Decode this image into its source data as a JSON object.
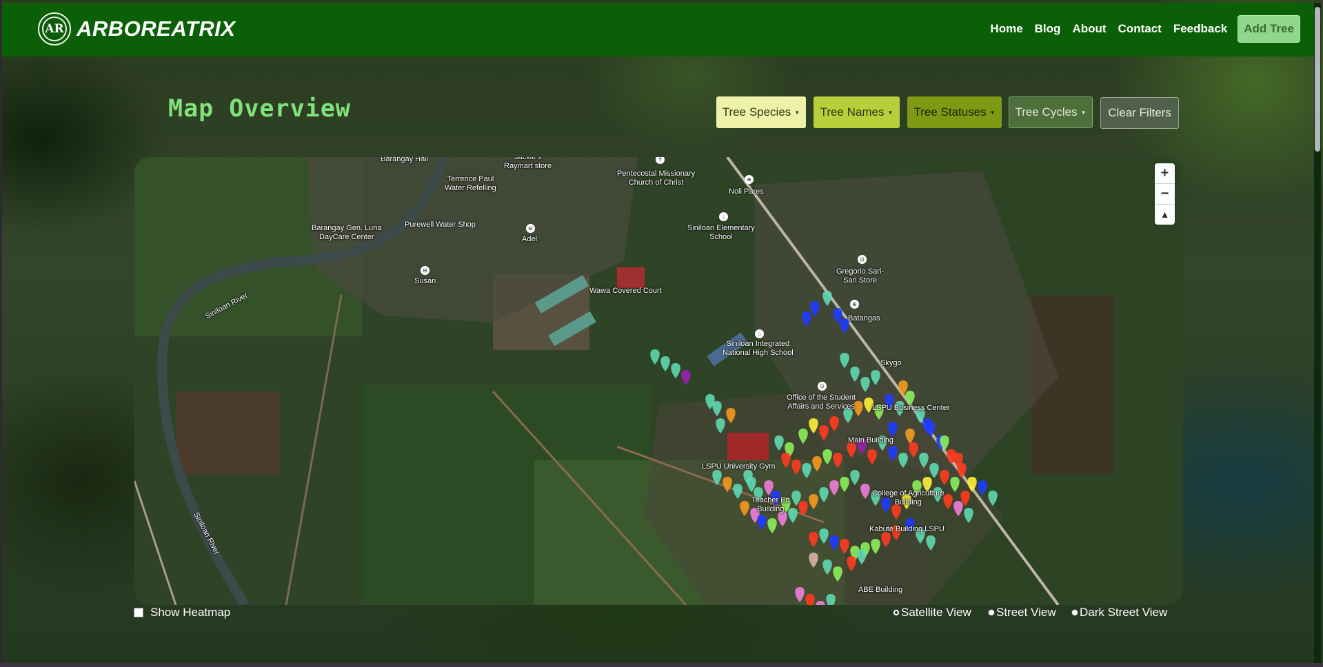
{
  "brand": {
    "name": "ARBOREATRIX",
    "logo_text": "AR"
  },
  "nav": {
    "links": [
      "Home",
      "Blog",
      "About",
      "Contact",
      "Feedback"
    ],
    "add_tree": "Add Tree"
  },
  "page": {
    "title": "Map Overview"
  },
  "filters": {
    "species": "Tree Species",
    "names": "Tree Names",
    "statuses": "Tree Statuses",
    "cycles": "Tree Cycles",
    "clear": "Clear Filters"
  },
  "map": {
    "labels": {
      "barangay_hall": "Barangay Hall",
      "jackie": "Jackie's\nRaymart store",
      "terrence": "Terrence Paul\nWater Refelling",
      "pentecostal": "Pentecostal Missionary\nChurch of Christ",
      "noli": "Noli Pares",
      "brgy_luna": "Barangay Gen. Luna\nDayCare Center",
      "purewell": "Purewell Water Shop",
      "adel": "Adel",
      "siniloan_elem": "Siniloan Elementary\nSchool",
      "gregorio": "Gregorio Sari-\nSari Store",
      "susan": "Susan",
      "wawa": "Wawa Covered Court",
      "river1": "Siniloan River",
      "batangas": "Batangas",
      "siniloan_integrated": "Siniloan Integrated\nNational High School",
      "skygo": "Skygo",
      "student_affairs": "Office of the Student\nAffairs and Services",
      "lspu_center": "LSPU Business Center",
      "lspu_building": "Main Building",
      "lspu_gym": "LSPU University Gym",
      "teacher": "Teacher Ed\nBuilding",
      "college_agri": "College of Agriculture\nBuilding",
      "kabute": "Kabute Building LSPU",
      "river2": "Siniloan River",
      "abe": "ABE Building"
    },
    "zoom_in": "+",
    "zoom_out": "−",
    "compass": "▲"
  },
  "controls": {
    "heatmap": "Show Heatmap",
    "satellite": "Satellite View",
    "street": "Street View",
    "dark_street": "Dark Street View",
    "selected_view": "Satellite View"
  },
  "colors": {
    "navbar": "#0b5f06",
    "title": "#7fe27b",
    "species_btn": "#eef2a8",
    "names_btn": "#b8ce3a",
    "statuses_btn": "#7e9a14",
    "cycles_btn": "#4d6f3a",
    "clear_btn": "#51604a"
  },
  "markers": {
    "colors": [
      "#5fd8b0",
      "#ff3b1f",
      "#1f3bff",
      "#8cf05a",
      "#f59a1f",
      "#f07dd8",
      "#9c1fb0",
      "#d8b0a0",
      "#ffef3a"
    ],
    "points": [
      [
        1170,
        460,
        2
      ],
      [
        1182,
        445,
        2
      ],
      [
        1200,
        430,
        0
      ],
      [
        1215,
        455,
        2
      ],
      [
        1225,
        470,
        2
      ],
      [
        950,
        515,
        0
      ],
      [
        965,
        525,
        0
      ],
      [
        980,
        535,
        0
      ],
      [
        995,
        545,
        6
      ],
      [
        1030,
        580,
        0
      ],
      [
        1040,
        590,
        0
      ],
      [
        1060,
        600,
        4
      ],
      [
        1045,
        615,
        0
      ],
      [
        1225,
        520,
        0
      ],
      [
        1240,
        540,
        0
      ],
      [
        1255,
        555,
        0
      ],
      [
        1270,
        545,
        0
      ],
      [
        1130,
        640,
        0
      ],
      [
        1145,
        650,
        3
      ],
      [
        1165,
        630,
        3
      ],
      [
        1180,
        615,
        8
      ],
      [
        1195,
        625,
        1
      ],
      [
        1210,
        612,
        1
      ],
      [
        1230,
        600,
        0
      ],
      [
        1245,
        590,
        4
      ],
      [
        1260,
        585,
        8
      ],
      [
        1275,
        595,
        3
      ],
      [
        1290,
        580,
        2
      ],
      [
        1305,
        590,
        0
      ],
      [
        1320,
        575,
        3
      ],
      [
        1335,
        600,
        0
      ],
      [
        1350,
        620,
        2
      ],
      [
        1365,
        640,
        2
      ],
      [
        1380,
        660,
        1
      ],
      [
        1395,
        680,
        1
      ],
      [
        1410,
        700,
        8
      ],
      [
        1425,
        705,
        2
      ],
      [
        1440,
        720,
        0
      ],
      [
        1310,
        560,
        4
      ],
      [
        1140,
        665,
        1
      ],
      [
        1155,
        675,
        1
      ],
      [
        1170,
        680,
        0
      ],
      [
        1185,
        670,
        4
      ],
      [
        1200,
        660,
        3
      ],
      [
        1215,
        665,
        1
      ],
      [
        1235,
        650,
        1
      ],
      [
        1250,
        645,
        6
      ],
      [
        1265,
        660,
        1
      ],
      [
        1280,
        640,
        0
      ],
      [
        1295,
        655,
        2
      ],
      [
        1310,
        665,
        0
      ],
      [
        1325,
        650,
        1
      ],
      [
        1340,
        665,
        0
      ],
      [
        1355,
        680,
        0
      ],
      [
        1370,
        690,
        1
      ],
      [
        1385,
        700,
        3
      ],
      [
        1400,
        720,
        1
      ],
      [
        1090,
        700,
        0
      ],
      [
        1100,
        715,
        0
      ],
      [
        1115,
        705,
        5
      ],
      [
        1125,
        720,
        2
      ],
      [
        1140,
        730,
        3
      ],
      [
        1155,
        720,
        0
      ],
      [
        1080,
        735,
        4
      ],
      [
        1095,
        745,
        5
      ],
      [
        1105,
        755,
        2
      ],
      [
        1120,
        760,
        3
      ],
      [
        1135,
        750,
        5
      ],
      [
        1150,
        745,
        0
      ],
      [
        1165,
        735,
        1
      ],
      [
        1180,
        725,
        4
      ],
      [
        1195,
        715,
        0
      ],
      [
        1210,
        705,
        5
      ],
      [
        1225,
        700,
        3
      ],
      [
        1240,
        690,
        0
      ],
      [
        1255,
        710,
        5
      ],
      [
        1270,
        720,
        0
      ],
      [
        1285,
        730,
        2
      ],
      [
        1300,
        740,
        1
      ],
      [
        1315,
        725,
        8
      ],
      [
        1330,
        705,
        3
      ],
      [
        1345,
        700,
        8
      ],
      [
        1360,
        715,
        0
      ],
      [
        1375,
        725,
        1
      ],
      [
        1390,
        735,
        5
      ],
      [
        1405,
        745,
        0
      ],
      [
        1180,
        780,
        1
      ],
      [
        1195,
        775,
        0
      ],
      [
        1210,
        785,
        2
      ],
      [
        1225,
        790,
        1
      ],
      [
        1240,
        800,
        3
      ],
      [
        1255,
        795,
        3
      ],
      [
        1270,
        790,
        3
      ],
      [
        1285,
        780,
        1
      ],
      [
        1300,
        770,
        1
      ],
      [
        1320,
        760,
        2
      ],
      [
        1335,
        775,
        0
      ],
      [
        1350,
        785,
        0
      ],
      [
        1180,
        810,
        7
      ],
      [
        1200,
        820,
        0
      ],
      [
        1215,
        830,
        3
      ],
      [
        1235,
        815,
        1
      ],
      [
        1250,
        805,
        0
      ],
      [
        1160,
        860,
        5
      ],
      [
        1175,
        870,
        1
      ],
      [
        1190,
        880,
        5
      ],
      [
        1205,
        870,
        0
      ],
      [
        1040,
        690,
        0
      ],
      [
        1055,
        700,
        4
      ],
      [
        1070,
        710,
        0
      ],
      [
        1085,
        690,
        0
      ],
      [
        1295,
        620,
        2
      ],
      [
        1320,
        630,
        4
      ],
      [
        1345,
        615,
        2
      ],
      [
        1370,
        640,
        3
      ],
      [
        1390,
        665,
        1
      ]
    ]
  }
}
